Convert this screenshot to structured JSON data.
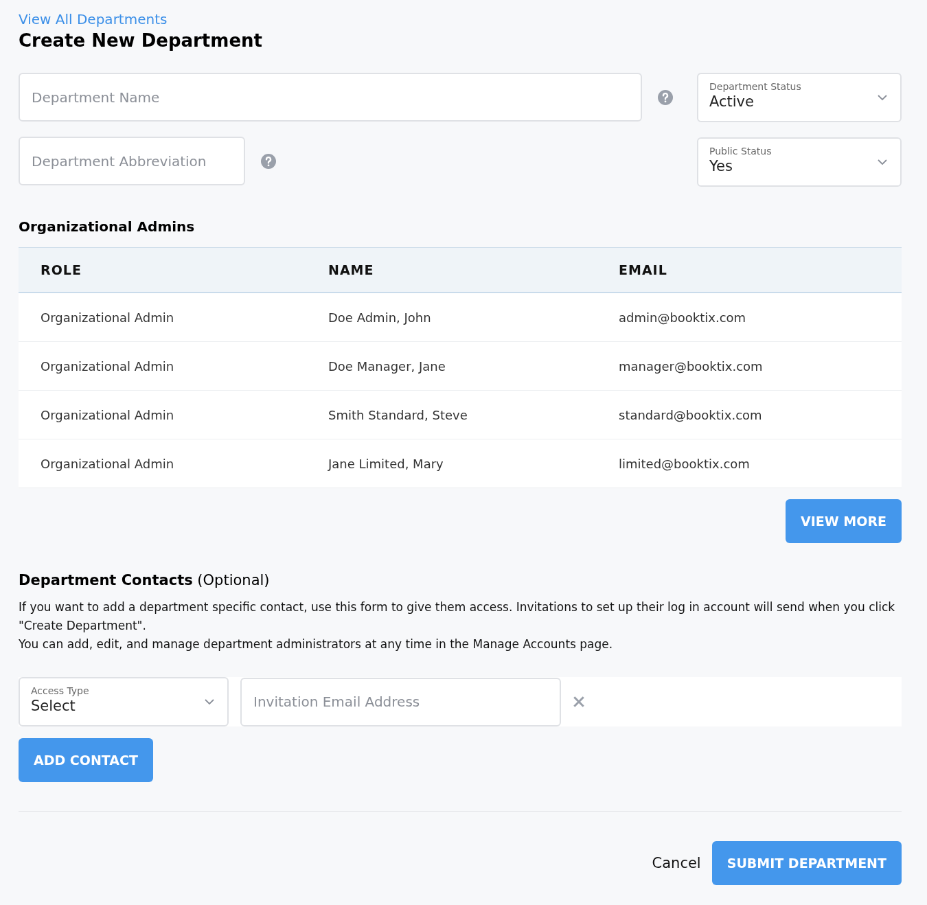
{
  "back_link": "View All Departments",
  "title": "Create New Department",
  "department_name": {
    "placeholder": "Department Name"
  },
  "department_abbreviation": {
    "placeholder": "Department Abbreviation"
  },
  "department_status": {
    "label": "Department Status",
    "value": "Active"
  },
  "public_status": {
    "label": "Public Status",
    "value": "Yes"
  },
  "admins": {
    "heading": "Organizational Admins",
    "columns": [
      "ROLE",
      "NAME",
      "EMAIL"
    ],
    "rows": [
      [
        "Organizational Admin",
        "Doe Admin, John",
        "admin@booktix.com"
      ],
      [
        "Organizational Admin",
        "Doe Manager, Jane",
        "manager@booktix.com"
      ],
      [
        "Organizational Admin",
        "Smith Standard, Steve",
        "standard@booktix.com"
      ],
      [
        "Organizational Admin",
        "Jane Limited, Mary",
        "limited@booktix.com"
      ]
    ],
    "view_more": "VIEW MORE"
  },
  "contacts": {
    "heading": "**Department Contacts** (Optional)",
    "paragraphs": [
      "If you want to add a department specific contact, use this form to give them access. Invitations to set up their log in account will send when you click \"Create Department\".",
      "You can add, edit, and manage department administrators at any time in the Manage Accounts page."
    ],
    "access_type": {
      "label": "Access Type",
      "value": "Select"
    },
    "email": {
      "placeholder": "Invitation Email Address"
    },
    "add_button": "ADD CONTACT"
  },
  "footer": {
    "cancel": "Cancel",
    "submit": "SUBMIT DEPARTMENT"
  }
}
